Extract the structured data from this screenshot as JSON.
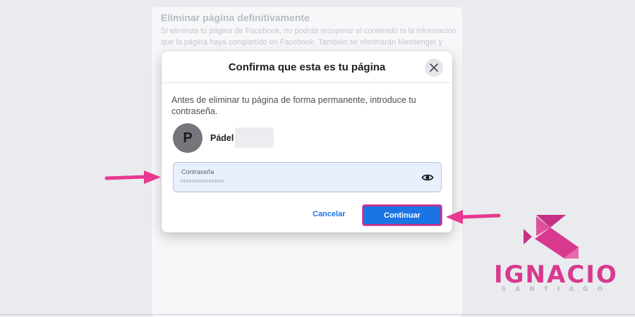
{
  "background": {
    "title": "Eliminar página definitivamente",
    "text": "Si eliminas tu página de Facebook, no podrás recuperar el contenido ni la información que la página haya compartido en Facebook. También se eliminarán Messenger y todos tus mensajes."
  },
  "dialog": {
    "title": "Confirma que esta es tu página",
    "close_icon": "close-icon",
    "description": "Antes de eliminar tu página de forma permanente, introduce tu contraseña.",
    "avatar_letter": "P",
    "page_name": "Pádel",
    "password": {
      "label": "Contraseña",
      "value": "••••••••••••",
      "toggle_icon": "eye-icon"
    },
    "cancel_label": "Cancelar",
    "continue_label": "Continuar"
  },
  "annotations": {
    "arrow_color": "#e8388f",
    "highlight_color": "#c2308b"
  },
  "logo": {
    "main": "IGNACIO",
    "sub": "SANTIAGO",
    "color": "#d8398f"
  },
  "colors": {
    "primary_button": "#1b74e4",
    "link": "#1b74e4",
    "field_bg": "#e8f0fe"
  }
}
